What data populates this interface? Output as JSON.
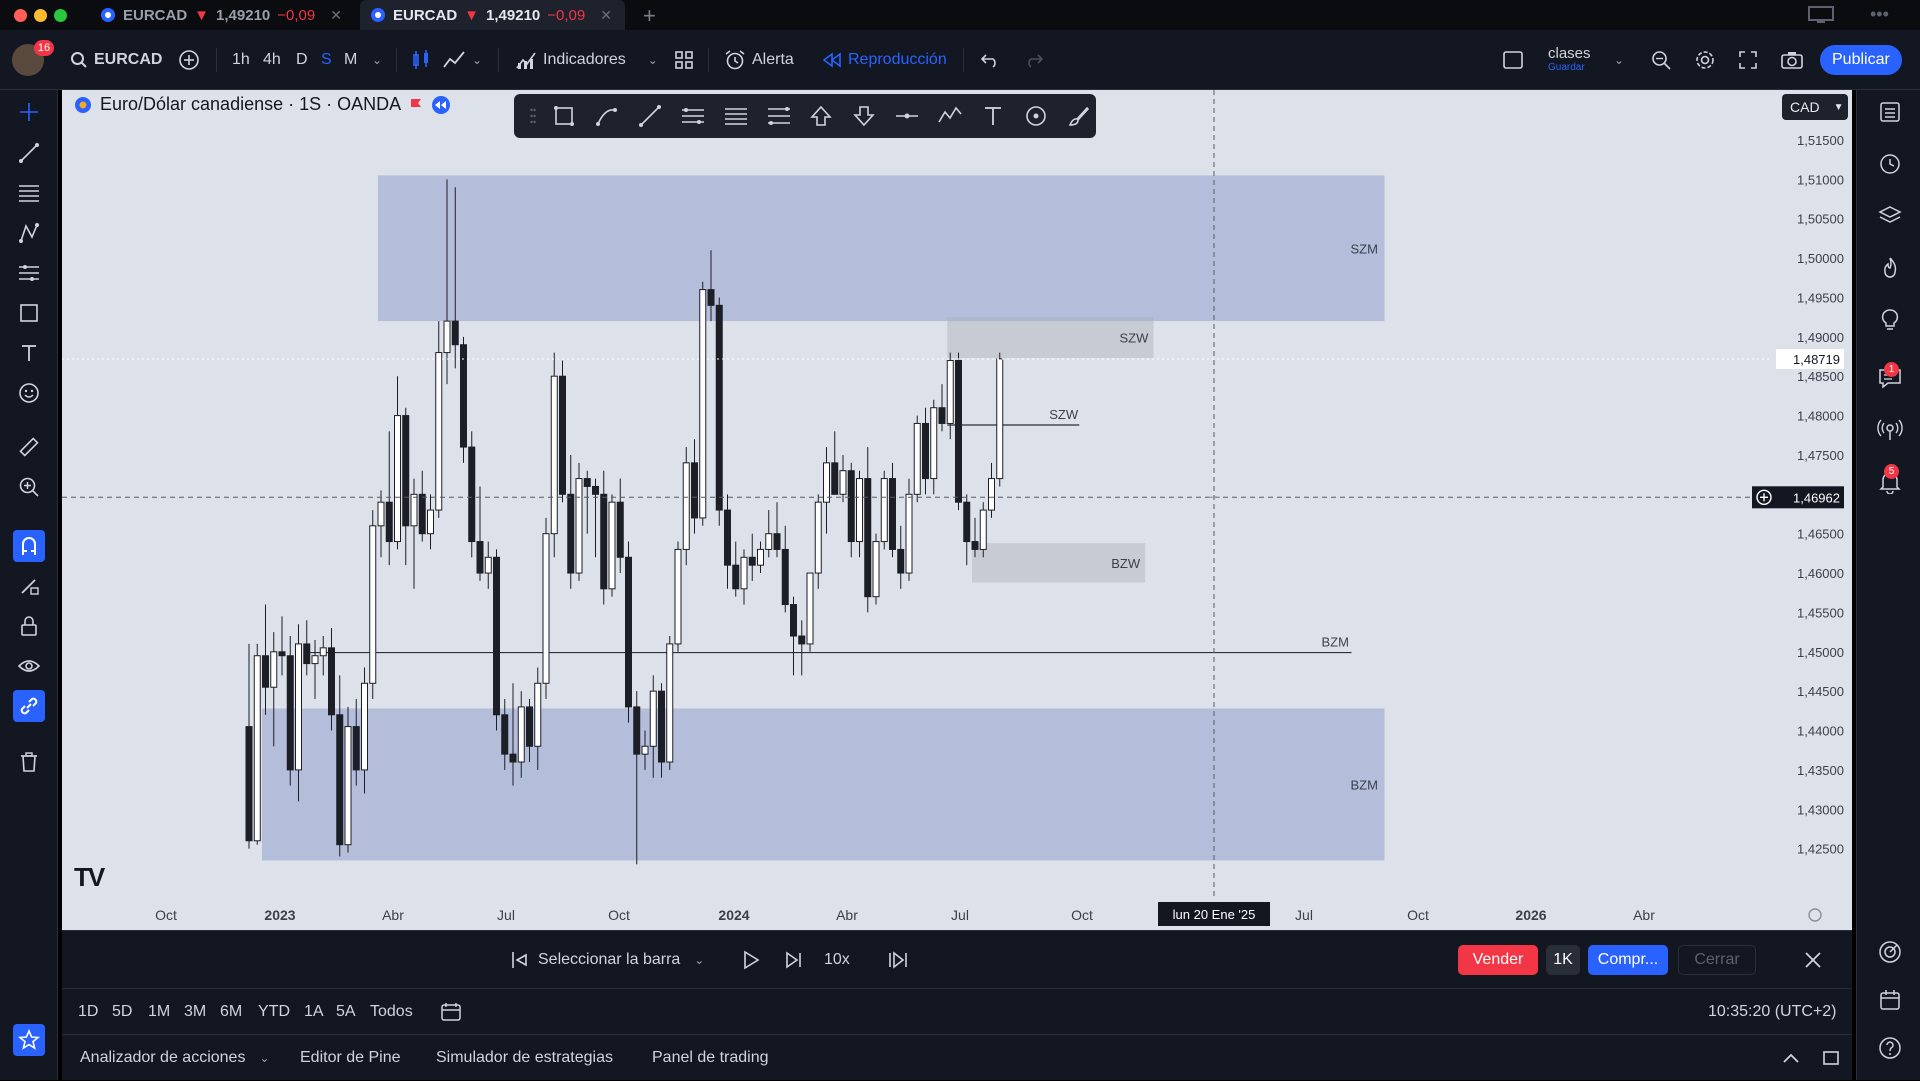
{
  "tabs": [
    {
      "symbol": "EURCAD",
      "arrow": "▼",
      "price": "1,49210",
      "change": "−0,09"
    },
    {
      "symbol": "EURCAD",
      "arrow": "▼",
      "price": "1,49210",
      "change": "−0,09"
    }
  ],
  "toolbar": {
    "avatar_badge": "16",
    "symbol": "EURCAD",
    "intervals": [
      "1h",
      "4h",
      "D",
      "S",
      "M"
    ],
    "indicators": "Indicadores",
    "alert": "Alerta",
    "replay": "Reproducción",
    "layout_name": "clases",
    "layout_sub": "Guardar",
    "publish": "Publicar"
  },
  "chart": {
    "title": "Euro/Dólar canadiense · 1S · OANDA",
    "currency": "CAD",
    "crosshair_price": "1,46962",
    "last_price": "1,48719",
    "crosshair_date": "lun 20 Ene '25",
    "logo": "TV"
  },
  "chart_data": {
    "type": "candlestick",
    "timeframe": "1S",
    "symbol": "EURCAD",
    "ylim": [
      1.42,
      1.515
    ],
    "y_ticks": [
      "1,51500",
      "1,51000",
      "1,50500",
      "1,50000",
      "1,49500",
      "1,49000",
      "1,48500",
      "1,48000",
      "1,47500",
      "1,46500",
      "1,46000",
      "1,45500",
      "1,45000",
      "1,44500",
      "1,44000",
      "1,43500",
      "1,43000",
      "1,42500"
    ],
    "x_ticks": [
      {
        "label": "Oct",
        "bold": false
      },
      {
        "label": "2023",
        "bold": true
      },
      {
        "label": "Abr",
        "bold": false
      },
      {
        "label": "Jul",
        "bold": false
      },
      {
        "label": "Oct",
        "bold": false
      },
      {
        "label": "2024",
        "bold": true
      },
      {
        "label": "Abr",
        "bold": false
      },
      {
        "label": "Jul",
        "bold": false
      },
      {
        "label": "Oct",
        "bold": false
      },
      {
        "label": "Abr",
        "bold": false
      },
      {
        "label": "Jul",
        "bold": false
      },
      {
        "label": "Oct",
        "bold": false
      },
      {
        "label": "2026",
        "bold": true
      },
      {
        "label": "Abr",
        "bold": false
      }
    ],
    "zones": [
      {
        "label": "SZM",
        "from_week": 16,
        "to_week": 138,
        "top": 1.5105,
        "bottom": 1.492,
        "color": "#7b8fc7"
      },
      {
        "label": "SZW",
        "from_week": 85,
        "to_week": 110,
        "top": 1.4925,
        "bottom": 1.4873,
        "color": "#a9adb8"
      },
      {
        "label": "BZW",
        "from_week": 88,
        "to_week": 109,
        "top": 1.4638,
        "bottom": 1.4588,
        "color": "#a9adb8"
      },
      {
        "label": "BZM",
        "from_week": 0,
        "to_week": 138,
        "top": 1.4428,
        "bottom": 1.4235,
        "color": "#7b8fc7"
      }
    ],
    "lines": [
      {
        "label": "SZW",
        "from_week": 85,
        "to_week": 101,
        "price": 1.4788
      },
      {
        "label": "BZM",
        "from_week": 0,
        "to_week": 134,
        "price": 1.4499
      }
    ],
    "candles": [
      {
        "o": 1.4405,
        "h": 1.451,
        "l": 1.425,
        "c": 1.426
      },
      {
        "o": 1.426,
        "h": 1.451,
        "l": 1.4255,
        "c": 1.4495
      },
      {
        "o": 1.4495,
        "h": 1.456,
        "l": 1.442,
        "c": 1.4455
      },
      {
        "o": 1.4455,
        "h": 1.4525,
        "l": 1.438,
        "c": 1.45
      },
      {
        "o": 1.45,
        "h": 1.4545,
        "l": 1.447,
        "c": 1.4495
      },
      {
        "o": 1.4495,
        "h": 1.452,
        "l": 1.433,
        "c": 1.435
      },
      {
        "o": 1.435,
        "h": 1.4535,
        "l": 1.431,
        "c": 1.451
      },
      {
        "o": 1.451,
        "h": 1.454,
        "l": 1.447,
        "c": 1.4485
      },
      {
        "o": 1.4485,
        "h": 1.4515,
        "l": 1.444,
        "c": 1.4495
      },
      {
        "o": 1.4495,
        "h": 1.452,
        "l": 1.447,
        "c": 1.4505
      },
      {
        "o": 1.4505,
        "h": 1.453,
        "l": 1.44,
        "c": 1.442
      },
      {
        "o": 1.442,
        "h": 1.447,
        "l": 1.424,
        "c": 1.4255
      },
      {
        "o": 1.4255,
        "h": 1.443,
        "l": 1.4245,
        "c": 1.4405
      },
      {
        "o": 1.4405,
        "h": 1.444,
        "l": 1.433,
        "c": 1.435
      },
      {
        "o": 1.435,
        "h": 1.448,
        "l": 1.432,
        "c": 1.446
      },
      {
        "o": 1.446,
        "h": 1.468,
        "l": 1.444,
        "c": 1.466
      },
      {
        "o": 1.466,
        "h": 1.4705,
        "l": 1.462,
        "c": 1.469
      },
      {
        "o": 1.469,
        "h": 1.478,
        "l": 1.461,
        "c": 1.464
      },
      {
        "o": 1.464,
        "h": 1.485,
        "l": 1.463,
        "c": 1.48
      },
      {
        "o": 1.48,
        "h": 1.481,
        "l": 1.461,
        "c": 1.466
      },
      {
        "o": 1.466,
        "h": 1.472,
        "l": 1.458,
        "c": 1.47
      },
      {
        "o": 1.47,
        "h": 1.473,
        "l": 1.464,
        "c": 1.465
      },
      {
        "o": 1.465,
        "h": 1.47,
        "l": 1.463,
        "c": 1.468
      },
      {
        "o": 1.468,
        "h": 1.492,
        "l": 1.467,
        "c": 1.488
      },
      {
        "o": 1.488,
        "h": 1.51,
        "l": 1.484,
        "c": 1.492
      },
      {
        "o": 1.492,
        "h": 1.509,
        "l": 1.486,
        "c": 1.489
      },
      {
        "o": 1.489,
        "h": 1.49,
        "l": 1.474,
        "c": 1.476
      },
      {
        "o": 1.476,
        "h": 1.478,
        "l": 1.462,
        "c": 1.464
      },
      {
        "o": 1.464,
        "h": 1.471,
        "l": 1.459,
        "c": 1.46
      },
      {
        "o": 1.46,
        "h": 1.464,
        "l": 1.458,
        "c": 1.462
      },
      {
        "o": 1.462,
        "h": 1.463,
        "l": 1.44,
        "c": 1.442
      },
      {
        "o": 1.442,
        "h": 1.444,
        "l": 1.435,
        "c": 1.437
      },
      {
        "o": 1.437,
        "h": 1.446,
        "l": 1.433,
        "c": 1.436
      },
      {
        "o": 1.436,
        "h": 1.445,
        "l": 1.434,
        "c": 1.443
      },
      {
        "o": 1.443,
        "h": 1.444,
        "l": 1.436,
        "c": 1.438
      },
      {
        "o": 1.438,
        "h": 1.448,
        "l": 1.435,
        "c": 1.446
      },
      {
        "o": 1.446,
        "h": 1.467,
        "l": 1.444,
        "c": 1.465
      },
      {
        "o": 1.465,
        "h": 1.488,
        "l": 1.462,
        "c": 1.485
      },
      {
        "o": 1.485,
        "h": 1.487,
        "l": 1.469,
        "c": 1.47
      },
      {
        "o": 1.47,
        "h": 1.475,
        "l": 1.458,
        "c": 1.46
      },
      {
        "o": 1.46,
        "h": 1.474,
        "l": 1.459,
        "c": 1.472
      },
      {
        "o": 1.472,
        "h": 1.473,
        "l": 1.465,
        "c": 1.471
      },
      {
        "o": 1.471,
        "h": 1.472,
        "l": 1.462,
        "c": 1.47
      },
      {
        "o": 1.47,
        "h": 1.473,
        "l": 1.456,
        "c": 1.458
      },
      {
        "o": 1.458,
        "h": 1.47,
        "l": 1.457,
        "c": 1.469
      },
      {
        "o": 1.469,
        "h": 1.472,
        "l": 1.46,
        "c": 1.462
      },
      {
        "o": 1.462,
        "h": 1.464,
        "l": 1.441,
        "c": 1.443
      },
      {
        "o": 1.443,
        "h": 1.445,
        "l": 1.423,
        "c": 1.437
      },
      {
        "o": 1.437,
        "h": 1.44,
        "l": 1.435,
        "c": 1.438
      },
      {
        "o": 1.438,
        "h": 1.447,
        "l": 1.434,
        "c": 1.445
      },
      {
        "o": 1.445,
        "h": 1.446,
        "l": 1.434,
        "c": 1.436
      },
      {
        "o": 1.436,
        "h": 1.452,
        "l": 1.435,
        "c": 1.451
      },
      {
        "o": 1.451,
        "h": 1.464,
        "l": 1.45,
        "c": 1.463
      },
      {
        "o": 1.463,
        "h": 1.476,
        "l": 1.461,
        "c": 1.474
      },
      {
        "o": 1.474,
        "h": 1.477,
        "l": 1.465,
        "c": 1.467
      },
      {
        "o": 1.467,
        "h": 1.497,
        "l": 1.466,
        "c": 1.496
      },
      {
        "o": 1.496,
        "h": 1.501,
        "l": 1.492,
        "c": 1.494
      },
      {
        "o": 1.494,
        "h": 1.495,
        "l": 1.466,
        "c": 1.468
      },
      {
        "o": 1.468,
        "h": 1.47,
        "l": 1.458,
        "c": 1.461
      },
      {
        "o": 1.461,
        "h": 1.464,
        "l": 1.457,
        "c": 1.458
      },
      {
        "o": 1.458,
        "h": 1.463,
        "l": 1.456,
        "c": 1.462
      },
      {
        "o": 1.462,
        "h": 1.465,
        "l": 1.459,
        "c": 1.461
      },
      {
        "o": 1.461,
        "h": 1.464,
        "l": 1.46,
        "c": 1.463
      },
      {
        "o": 1.463,
        "h": 1.468,
        "l": 1.462,
        "c": 1.465
      },
      {
        "o": 1.465,
        "h": 1.469,
        "l": 1.462,
        "c": 1.463
      },
      {
        "o": 1.463,
        "h": 1.466,
        "l": 1.455,
        "c": 1.456
      },
      {
        "o": 1.456,
        "h": 1.457,
        "l": 1.447,
        "c": 1.452
      },
      {
        "o": 1.452,
        "h": 1.454,
        "l": 1.447,
        "c": 1.451
      },
      {
        "o": 1.451,
        "h": 1.46,
        "l": 1.45,
        "c": 1.46
      },
      {
        "o": 1.46,
        "h": 1.47,
        "l": 1.458,
        "c": 1.469
      },
      {
        "o": 1.469,
        "h": 1.476,
        "l": 1.465,
        "c": 1.474
      },
      {
        "o": 1.474,
        "h": 1.478,
        "l": 1.47,
        "c": 1.47
      },
      {
        "o": 1.47,
        "h": 1.475,
        "l": 1.469,
        "c": 1.473
      },
      {
        "o": 1.473,
        "h": 1.474,
        "l": 1.462,
        "c": 1.464
      },
      {
        "o": 1.464,
        "h": 1.473,
        "l": 1.462,
        "c": 1.472
      },
      {
        "o": 1.472,
        "h": 1.476,
        "l": 1.455,
        "c": 1.457
      },
      {
        "o": 1.457,
        "h": 1.465,
        "l": 1.456,
        "c": 1.464
      },
      {
        "o": 1.464,
        "h": 1.473,
        "l": 1.463,
        "c": 1.472
      },
      {
        "o": 1.472,
        "h": 1.474,
        "l": 1.462,
        "c": 1.463
      },
      {
        "o": 1.463,
        "h": 1.466,
        "l": 1.458,
        "c": 1.46
      },
      {
        "o": 1.46,
        "h": 1.472,
        "l": 1.459,
        "c": 1.47
      },
      {
        "o": 1.47,
        "h": 1.48,
        "l": 1.469,
        "c": 1.479
      },
      {
        "o": 1.479,
        "h": 1.481,
        "l": 1.47,
        "c": 1.472
      },
      {
        "o": 1.472,
        "h": 1.482,
        "l": 1.47,
        "c": 1.481
      },
      {
        "o": 1.481,
        "h": 1.484,
        "l": 1.478,
        "c": 1.479
      },
      {
        "o": 1.479,
        "h": 1.488,
        "l": 1.477,
        "c": 1.487
      },
      {
        "o": 1.487,
        "h": 1.488,
        "l": 1.468,
        "c": 1.469
      },
      {
        "o": 1.469,
        "h": 1.47,
        "l": 1.461,
        "c": 1.464
      },
      {
        "o": 1.464,
        "h": 1.467,
        "l": 1.462,
        "c": 1.463
      },
      {
        "o": 1.463,
        "h": 1.469,
        "l": 1.462,
        "c": 1.468
      },
      {
        "o": 1.468,
        "h": 1.474,
        "l": 1.467,
        "c": 1.472
      },
      {
        "o": 1.472,
        "h": 1.488,
        "l": 1.471,
        "c": 1.4872
      }
    ]
  },
  "replay_bar": {
    "select_bar": "Seleccionar la barra",
    "speed": "10x",
    "sell": "Vender",
    "qty": "1K",
    "buy": "Compr...",
    "close": "Cerrar"
  },
  "range_bar": {
    "ranges": [
      "1D",
      "5D",
      "1M",
      "3M",
      "6M",
      "YTD",
      "1A",
      "5A",
      "Todos"
    ],
    "time": "10:35:20 (UTC+2)"
  },
  "bottom_panel": {
    "tabs": [
      "Analizador de acciones",
      "Editor de Pine",
      "Simulador de estrategias",
      "Panel de trading"
    ]
  },
  "right_badges": [
    "1",
    "5"
  ],
  "colors": {
    "accent": "#2962ff",
    "sell": "#f23645",
    "chart_bg": "#dde1e9",
    "toolbar_bg": "#131722"
  }
}
